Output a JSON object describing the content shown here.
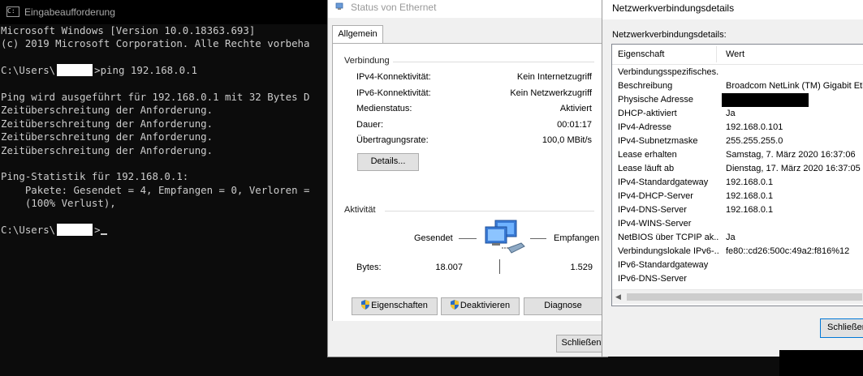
{
  "console": {
    "title": "Eingabeaufforderung",
    "lines": [
      {
        "pre": "Microsoft Windows [Version 10.0.18363.693]"
      },
      {
        "pre": "(c) 2019 Microsoft Corporation. Alle Rechte vorbeha"
      },
      {
        "pre": ""
      },
      {
        "pre": "C:\\Users\\",
        "redacted": true,
        "post": ">ping 192.168.0.1"
      },
      {
        "pre": ""
      },
      {
        "pre": "Ping wird ausgeführt für 192.168.0.1 mit 32 Bytes D"
      },
      {
        "pre": "Zeitüberschreitung der Anforderung."
      },
      {
        "pre": "Zeitüberschreitung der Anforderung."
      },
      {
        "pre": "Zeitüberschreitung der Anforderung."
      },
      {
        "pre": "Zeitüberschreitung der Anforderung."
      },
      {
        "pre": ""
      },
      {
        "pre": "Ping-Statistik für 192.168.0.1:"
      },
      {
        "pre": "    Pakete: Gesendet = 4, Empfangen = 0, Verloren ="
      },
      {
        "pre": "    (100% Verlust),"
      },
      {
        "pre": ""
      },
      {
        "pre": "C:\\Users\\",
        "redacted": true,
        "post": ">",
        "cursor": true
      }
    ]
  },
  "status": {
    "title": "Status von Ethernet",
    "tab": "Allgemein",
    "connection": {
      "heading": "Verbindung",
      "rows": [
        {
          "label": "IPv4-Konnektivität:",
          "value": "Kein Internetzugriff"
        },
        {
          "label": "IPv6-Konnektivität:",
          "value": "Kein Netzwerkzugriff"
        },
        {
          "label": "Medienstatus:",
          "value": "Aktiviert"
        },
        {
          "label": "Dauer:",
          "value": "00:01:17"
        },
        {
          "label": "Übertragungsrate:",
          "value": "100,0 MBit/s"
        }
      ],
      "details_button": "Details..."
    },
    "activity": {
      "heading": "Aktivität",
      "sent_label": "Gesendet",
      "received_label": "Empfangen",
      "bytes_label": "Bytes:",
      "bytes_sent": "18.007",
      "bytes_received": "1.529"
    },
    "buttons": {
      "properties": "Eigenschaften",
      "disable": "Deaktivieren",
      "diagnose": "Diagnose",
      "close": "Schließen"
    },
    "shield_color": "#2a6cc7"
  },
  "details": {
    "title": "Netzwerkverbindungsdetails",
    "subtitle": "Netzwerkverbindungsdetails:",
    "columns": {
      "property": "Eigenschaft",
      "value": "Wert"
    },
    "rows": [
      {
        "property": "Verbindungsspezifisches...",
        "value": ""
      },
      {
        "property": "Beschreibung",
        "value": "Broadcom NetLink (TM) Gigabit Ethe"
      },
      {
        "property": "Physische Adresse",
        "value": "",
        "redacted": true
      },
      {
        "property": "DHCP-aktiviert",
        "value": "Ja"
      },
      {
        "property": "IPv4-Adresse",
        "value": "192.168.0.101"
      },
      {
        "property": "IPv4-Subnetzmaske",
        "value": "255.255.255.0"
      },
      {
        "property": "Lease erhalten",
        "value": "Samstag, 7. März 2020 16:37:06"
      },
      {
        "property": "Lease läuft ab",
        "value": "Dienstag, 17. März 2020 16:37:05"
      },
      {
        "property": "IPv4-Standardgateway",
        "value": "192.168.0.1"
      },
      {
        "property": "IPv4-DHCP-Server",
        "value": "192.168.0.1"
      },
      {
        "property": "IPv4-DNS-Server",
        "value": "192.168.0.1"
      },
      {
        "property": "IPv4-WINS-Server",
        "value": ""
      },
      {
        "property": "NetBIOS über TCPIP ak...",
        "value": "Ja"
      },
      {
        "property": "Verbindungslokale IPv6-...",
        "value": "fe80::cd26:500c:49a2:f816%12"
      },
      {
        "property": "IPv6-Standardgateway",
        "value": ""
      },
      {
        "property": "IPv6-DNS-Server",
        "value": ""
      }
    ],
    "close_button": "Schließen"
  }
}
